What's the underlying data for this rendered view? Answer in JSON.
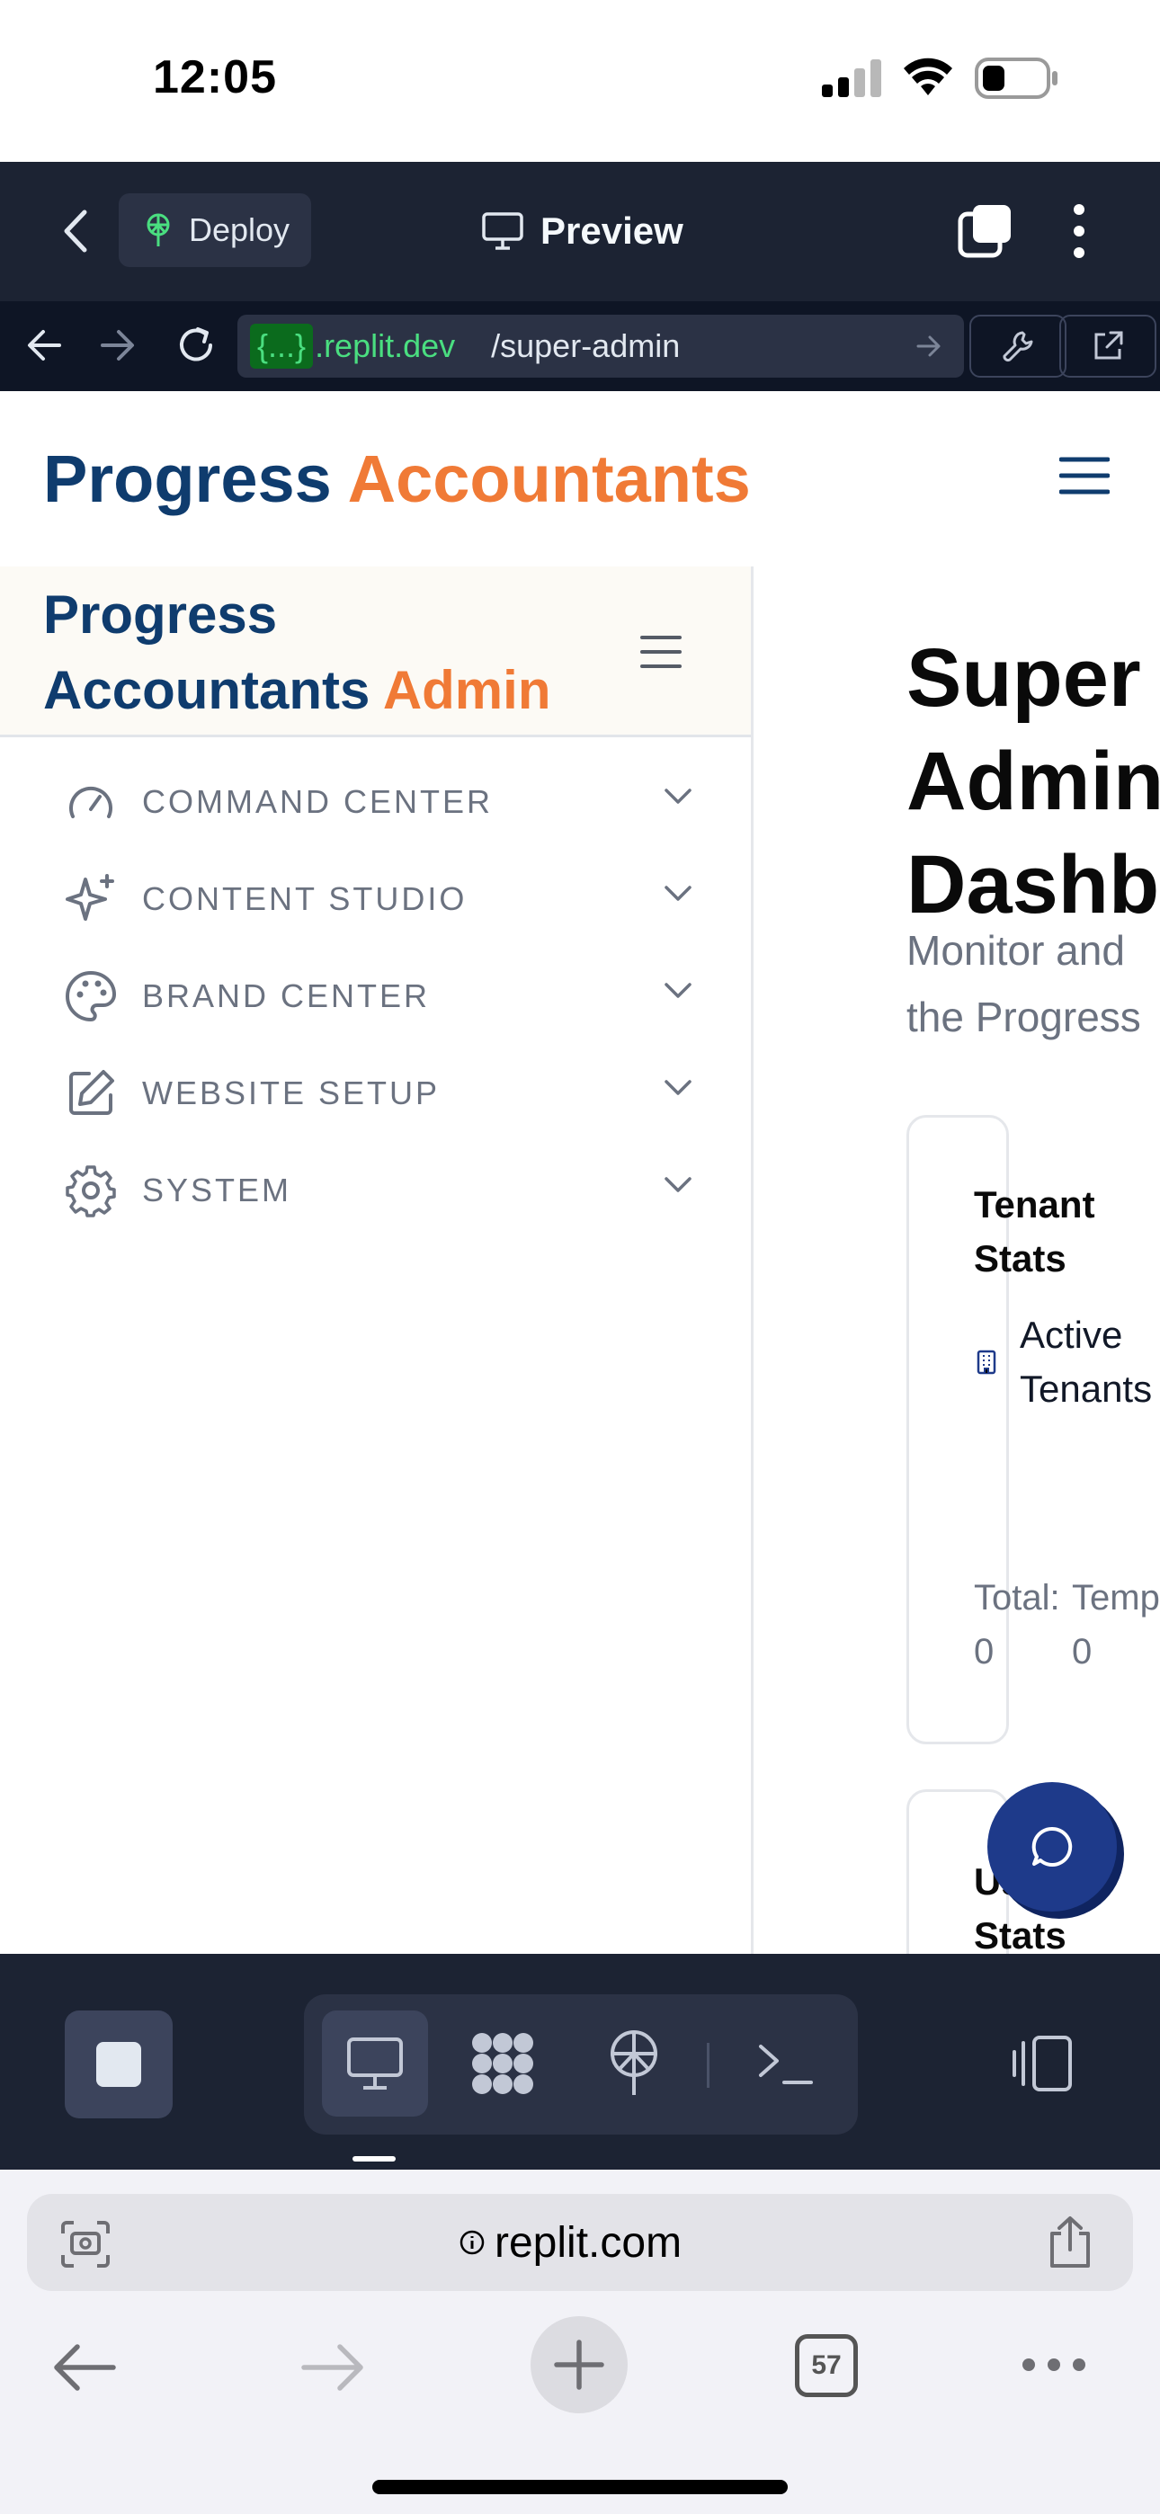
{
  "status_bar": {
    "time": "12:05"
  },
  "replit_header": {
    "deploy_label": "Deploy",
    "preview_label": "Preview"
  },
  "url_bar": {
    "chip": "{...}",
    "domain": ".replit.dev",
    "path": "/super-admin"
  },
  "app": {
    "brand_part1": "Progress",
    "brand_part2": "Accountants",
    "sidebar": {
      "title_line1": "Progress",
      "title_line2": "Accountants",
      "title_accent": "Admin",
      "items": [
        {
          "label": "COMMAND CENTER",
          "icon": "gauge-icon"
        },
        {
          "label": "CONTENT STUDIO",
          "icon": "sparkles-icon"
        },
        {
          "label": "BRAND CENTER",
          "icon": "palette-icon"
        },
        {
          "label": "WEBSITE SETUP",
          "icon": "edit-icon"
        },
        {
          "label": "SYSTEM",
          "icon": "gear-icon"
        }
      ]
    },
    "main": {
      "title_line1": "Super",
      "title_line2": "Admin",
      "title_line3": "Dashb",
      "subtitle_line1": "Monitor and",
      "subtitle_line2": "the Progress",
      "tenant_card": {
        "title_line1": "Tenant",
        "title_line2": "Stats",
        "metric_line1": "Active",
        "metric_line2": "Tenants",
        "total_label": "Total:",
        "total_value": "0",
        "temp_label": "Temp",
        "temp_value": "0"
      },
      "user_card": {
        "title_line1": "Us",
        "title_line2": "Stats"
      }
    }
  },
  "safari": {
    "url": "replit.com",
    "tab_count": "57"
  },
  "colors": {
    "brand_navy": "#0f3c6e",
    "brand_orange": "#f07a36",
    "replit_bg": "#1c2333",
    "replit_green": "#4ade80"
  }
}
